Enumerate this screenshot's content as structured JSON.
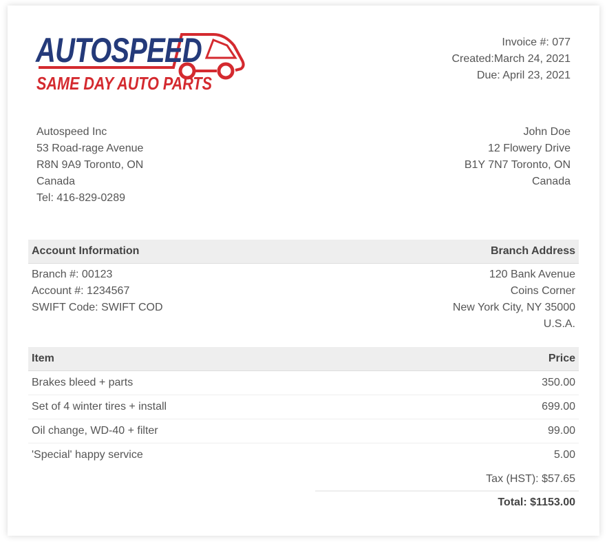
{
  "logo": {
    "brand": "AUTOSPEED",
    "tagline": "SAME DAY AUTO PARTS",
    "icon": "car-logo-icon",
    "colors": {
      "blue": "#243a7a",
      "red": "#d42a2f"
    }
  },
  "invoice": {
    "number": "Invoice #: 077",
    "created": "Created:March 24, 2021",
    "due": "Due: April 23, 2021"
  },
  "from": {
    "name": "Autospeed Inc",
    "street": "53 Road-rage Avenue",
    "city": "R8N 9A9 Toronto, ON",
    "country": "Canada",
    "tel": "Tel: 416-829-0289"
  },
  "to": {
    "name": "John Doe",
    "street": "12 Flowery Drive",
    "city": "B1Y 7N7 Toronto, ON",
    "country": "Canada"
  },
  "account": {
    "header_left": "Account Information",
    "header_right": "Branch Address",
    "branch": "Branch #: 00123",
    "account": "Account #: 1234567",
    "swift": "SWIFT Code: SWIFT COD",
    "addr1": "120 Bank Avenue",
    "addr2": "Coins Corner",
    "addr3": "New York City, NY 35000",
    "addr4": "U.S.A."
  },
  "items": {
    "header_left": "Item",
    "header_right": "Price",
    "rows": [
      {
        "name": "Brakes bleed + parts",
        "price": "350.00"
      },
      {
        "name": "Set of 4 winter tires + install",
        "price": "699.00"
      },
      {
        "name": "Oil change, WD-40 + filter",
        "price": "99.00"
      },
      {
        "name": "'Special' happy service",
        "price": "5.00"
      }
    ]
  },
  "tax": "Tax (HST): $57.65",
  "total": "Total: $1153.00"
}
